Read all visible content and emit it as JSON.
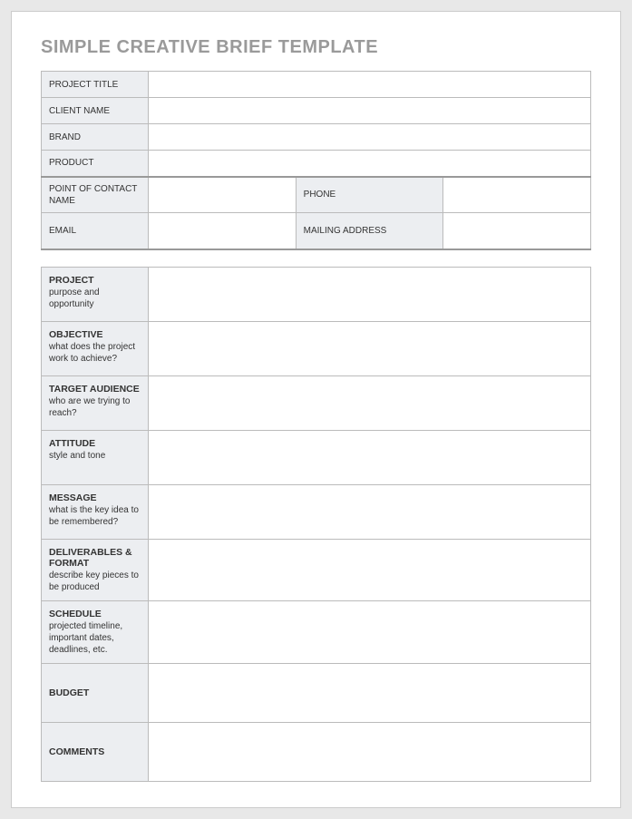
{
  "title": "SIMPLE CREATIVE BRIEF TEMPLATE",
  "header": {
    "projectTitle": {
      "label": "PROJECT TITLE",
      "value": ""
    },
    "clientName": {
      "label": "CLIENT NAME",
      "value": ""
    },
    "brand": {
      "label": "BRAND",
      "value": ""
    },
    "product": {
      "label": "PRODUCT",
      "value": ""
    },
    "pointOfContact": {
      "label": "POINT OF CONTACT NAME",
      "value": ""
    },
    "phone": {
      "label": "PHONE",
      "value": ""
    },
    "email": {
      "label": "EMAIL",
      "value": ""
    },
    "mailingAddress": {
      "label": "MAILING ADDRESS",
      "value": ""
    }
  },
  "sections": {
    "project": {
      "heading": "PROJECT",
      "sub": "purpose and opportunity",
      "value": ""
    },
    "objective": {
      "heading": "OBJECTIVE",
      "sub": "what does the project work to achieve?",
      "value": ""
    },
    "targetAudience": {
      "heading": "TARGET AUDIENCE",
      "sub": "who are we trying to reach?",
      "value": ""
    },
    "attitude": {
      "heading": "ATTITUDE",
      "sub": "style and tone",
      "value": ""
    },
    "message": {
      "heading": "MESSAGE",
      "sub": "what is the key idea to be remembered?",
      "value": ""
    },
    "deliverables": {
      "heading": "DELIVERABLES & FORMAT",
      "sub": " describe key pieces to be produced",
      "value": ""
    },
    "schedule": {
      "heading": "SCHEDULE",
      "sub": "projected timeline, important dates, deadlines, etc.",
      "value": ""
    },
    "budget": {
      "heading": "BUDGET",
      "sub": "",
      "value": ""
    },
    "comments": {
      "heading": "COMMENTS",
      "sub": "",
      "value": ""
    }
  }
}
